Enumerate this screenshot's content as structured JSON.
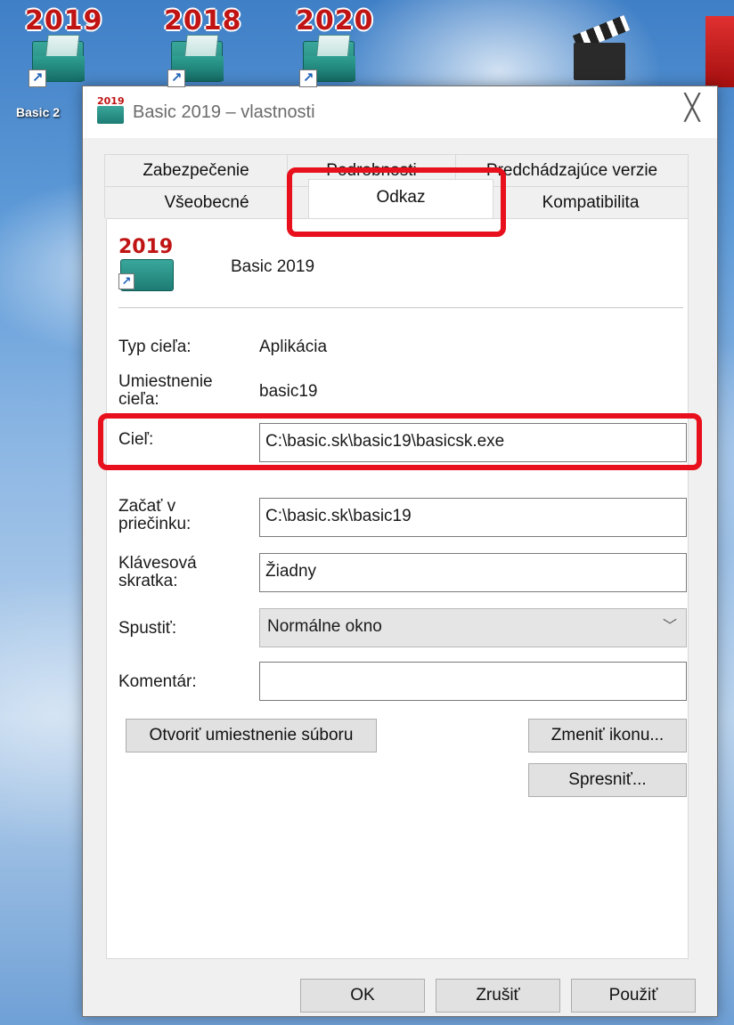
{
  "desktop": {
    "icons": [
      {
        "year": "2019",
        "label": "Basic 2"
      },
      {
        "year": "2018"
      },
      {
        "year": "2020"
      }
    ]
  },
  "dialog": {
    "title": "Basic 2019 – vlastnosti",
    "close_glyph": "╳",
    "tabs": {
      "row1": [
        "Zabezpečenie",
        "Podrobnosti",
        "Predchádzajúce verzie"
      ],
      "row2": [
        "Všeobecné",
        "Odkaz",
        "Kompatibilita"
      ],
      "active": "Odkaz"
    },
    "header": {
      "icon_year": "2019",
      "name": "Basic 2019"
    },
    "fields": {
      "type_label": "Typ cieľa:",
      "type_value": "Aplikácia",
      "location_label": "Umiestnenie cieľa:",
      "location_value": "basic19",
      "target_label": "Cieľ:",
      "target_value": "C:\\basic.sk\\basic19\\basicsk.exe",
      "start_in_label": "Začať v priečinku:",
      "start_in_value": "C:\\basic.sk\\basic19",
      "hotkey_label": "Klávesová skratka:",
      "hotkey_value": "Žiadny",
      "run_label": "Spustiť:",
      "run_value": "Normálne okno",
      "comment_label": "Komentár:",
      "comment_value": ""
    },
    "buttons": {
      "open_location": "Otvoriť umiestnenie súboru",
      "change_icon": "Zmeniť ikonu...",
      "advanced": "Spresniť...",
      "ok": "OK",
      "cancel": "Zrušiť",
      "apply": "Použiť"
    }
  },
  "colors": {
    "highlight": "#e8101c",
    "brand_year": "#c01414",
    "folder_teal": "#1d7c74"
  },
  "icons": [
    "shortcut-arrow-icon",
    "folder-icon",
    "clapperboard-icon",
    "chevron-down-icon",
    "close-icon"
  ]
}
